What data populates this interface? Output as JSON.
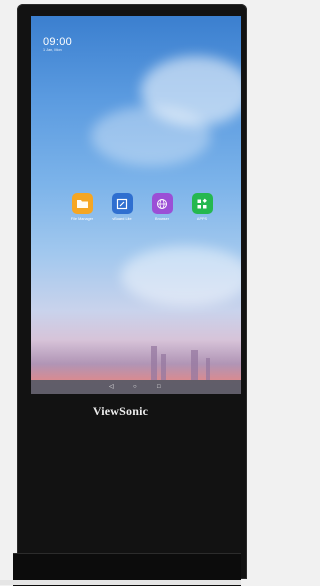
{
  "device": {
    "brand": "ViewSonic"
  },
  "status": {
    "time": "09:00",
    "date": "1 Jan, Mon"
  },
  "apps": [
    {
      "label": "File Manager",
      "icon": "folder-icon",
      "color": "#f5a623"
    },
    {
      "label": "vBoard Lite",
      "icon": "whiteboard-icon",
      "color": "#2f6fd0"
    },
    {
      "label": "Browser",
      "icon": "globe-icon",
      "color": "#9b4fd6"
    },
    {
      "label": "APPS",
      "icon": "apps-grid-icon",
      "color": "#25b84f"
    }
  ],
  "navigation": {
    "back": "◁",
    "home": "○",
    "recent": "□"
  }
}
